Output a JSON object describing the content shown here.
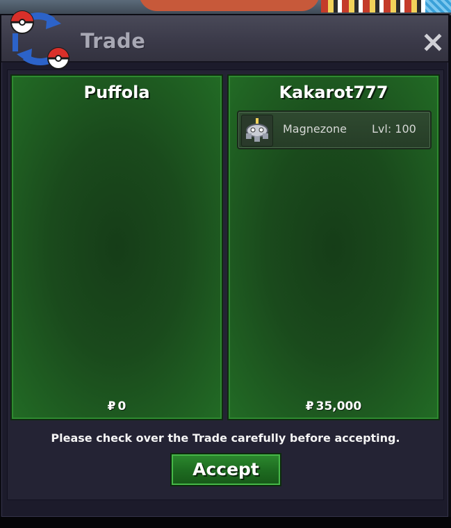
{
  "window": {
    "title": "Trade",
    "close_icon": "close-icon",
    "logo_icon": "trade-pokeball-logo-icon"
  },
  "players": [
    {
      "name": "Puffola",
      "money_symbol": "₽",
      "money": "0",
      "items": []
    },
    {
      "name": "Kakarot777",
      "money_symbol": "₽",
      "money": "35,000",
      "items": [
        {
          "name": "Magnezone",
          "level": "Lvl: 100",
          "icon": "magnezone-sprite-icon"
        }
      ]
    }
  ],
  "notice": "Please check over the Trade carefully before accepting.",
  "accept_label": "Accept",
  "colors": {
    "panel_green": "#1a4a1c",
    "accept_green": "#1d6a20",
    "window_bg": "#1c1b2b"
  }
}
